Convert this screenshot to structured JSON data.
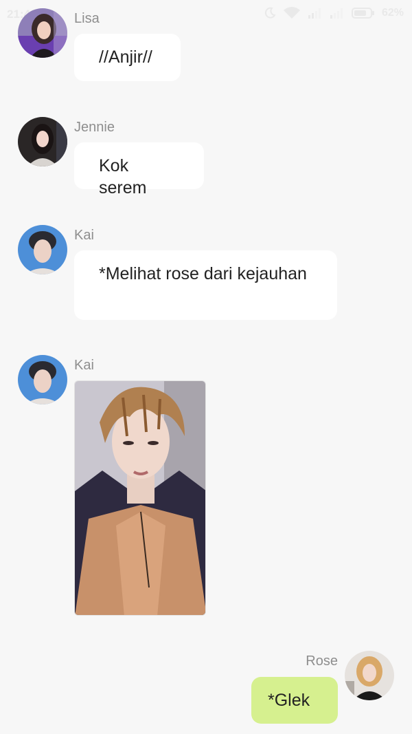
{
  "status_bar": {
    "time": "21:42",
    "battery": "62%"
  },
  "messages": [
    {
      "sender": "Lisa",
      "text": "//Anjir//"
    },
    {
      "sender": "Jennie",
      "text": "Kok serem"
    },
    {
      "sender": "Kai",
      "text": "*Melihat rose dari kejauhan"
    },
    {
      "sender": "Kai",
      "media": "photo"
    },
    {
      "sender": "Rose",
      "text": "*Glek",
      "mine": true
    }
  ],
  "colors": {
    "background": "#f7f7f7",
    "incoming_bubble": "#ffffff",
    "outgoing_bubble": "#d6f08f",
    "sender_name": "#8e8e8e",
    "message_text": "#222222"
  }
}
